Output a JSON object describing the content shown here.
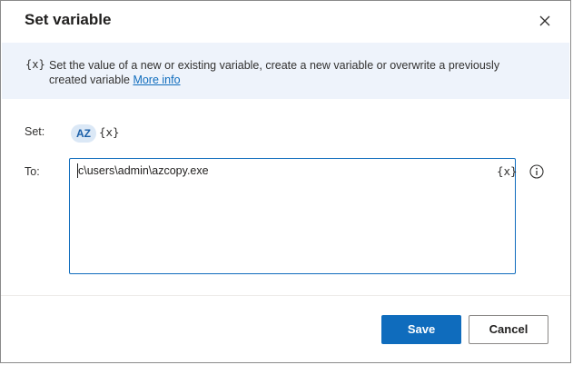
{
  "dialog": {
    "title": "Set variable",
    "close_icon": "close-icon"
  },
  "banner": {
    "icon_text": "{x}",
    "text": "Set the value of a new or existing variable, create a new variable or overwrite a previously created variable",
    "link": "More info"
  },
  "set_row": {
    "label": "Set:",
    "variable_name": "AZ",
    "variable_picker": "{x}"
  },
  "to_row": {
    "label": "To:",
    "value": "c\\users\\admin\\azcopy.exe",
    "variable_picker": "{x}",
    "info_icon": "info-icon"
  },
  "footer": {
    "save_label": "Save",
    "cancel_label": "Cancel"
  },
  "colors": {
    "accent": "#0f6cbd",
    "banner_bg": "#eef3fb",
    "chip_bg": "#dbe8f6"
  }
}
